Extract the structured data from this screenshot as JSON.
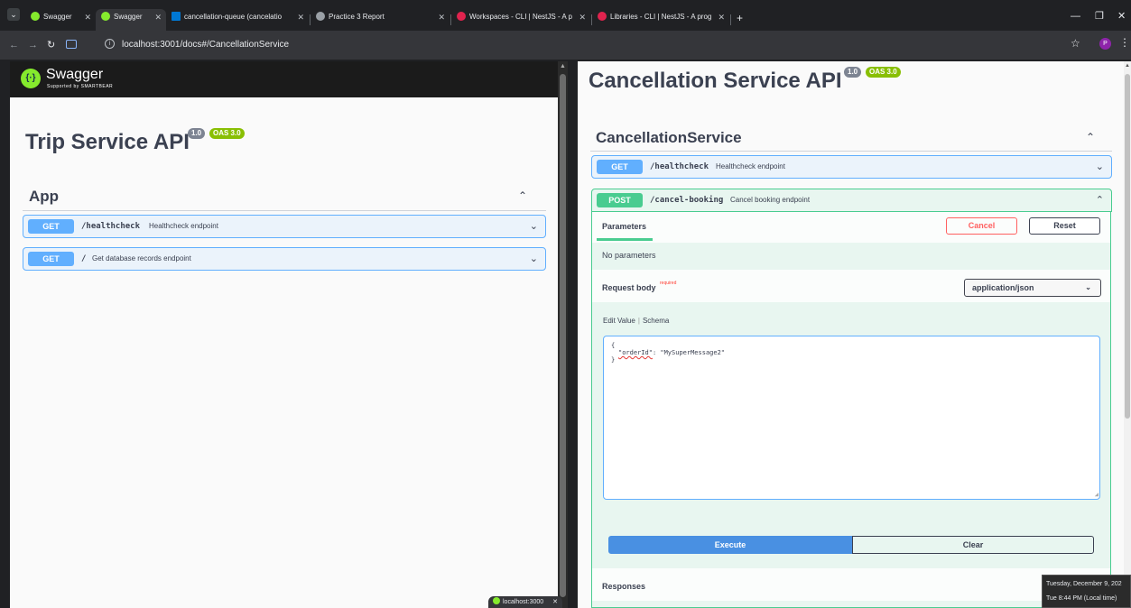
{
  "browser": {
    "tabs": [
      {
        "label": "Swagger",
        "active": false,
        "icon": "swagger-icon"
      },
      {
        "label": "Swagger",
        "active": true,
        "icon": "swagger-icon"
      },
      {
        "label": "cancellation-queue (cancelatio",
        "active": false,
        "icon": "azure-icon"
      },
      {
        "label": "Practice 3 Report",
        "active": false,
        "icon": "globe-icon"
      },
      {
        "label": "Workspaces - CLI | NestJS - A p",
        "active": false,
        "icon": "nestjs-icon"
      },
      {
        "label": "Libraries - CLI | NestJS - A prog",
        "active": false,
        "icon": "nestjs-icon"
      }
    ],
    "close_glyph": "✕",
    "new_tab_glyph": "+",
    "window_controls": {
      "minimize": "—",
      "restore": "❐",
      "close": "✕"
    },
    "url": "localhost:3001/docs#/CancellationService",
    "profile_initial": "P",
    "mini_tab_label": "localhost:3000",
    "colors": {
      "swagger_green": "#85ea2d",
      "azure_blue": "#0078d4",
      "nest_red": "#e0234e",
      "profile": "#8e24aa"
    }
  },
  "left": {
    "header": {
      "brand": "Swagger",
      "sub": "Supported by SMARTBEAR"
    },
    "title": "Trip Service API",
    "version_badge": "1.0",
    "oas_badge": "OAS 3.0",
    "tag": "App",
    "operations": [
      {
        "method": "GET",
        "path": "/healthcheck",
        "summary": "Healthcheck endpoint"
      },
      {
        "method": "GET",
        "path": "/",
        "summary": "Get database records endpoint"
      }
    ]
  },
  "right": {
    "title": "Cancellation Service API",
    "version_badge": "1.0",
    "oas_badge": "OAS 3.0",
    "tag": "CancellationService",
    "operations": [
      {
        "method": "GET",
        "path": "/healthcheck",
        "summary": "Healthcheck endpoint"
      },
      {
        "method": "POST",
        "path": "/cancel-booking",
        "summary": "Cancel booking endpoint"
      }
    ],
    "parameters_tab": "Parameters",
    "cancel_label": "Cancel",
    "reset_label": "Reset",
    "no_parameters": "No parameters",
    "request_body_label": "Request body",
    "required_label": "required",
    "content_type": "application/json",
    "edit_value_tab": "Edit Value",
    "schema_tab": "Schema",
    "body": {
      "open": "{",
      "key": "\"orderId\"",
      "value": ": \"MySuperMessage2\"",
      "close": "}"
    },
    "execute_label": "Execute",
    "clear_label": "Clear",
    "responses_label": "Responses",
    "method_colors": {
      "get": "#61affe",
      "post": "#49cc90",
      "cancel": "#ff6060",
      "execute": "#4990e2"
    }
  },
  "clock_tooltip": {
    "date": "Tuesday, December 9, 202",
    "time": "Tue 8:44 PM (Local time)"
  }
}
